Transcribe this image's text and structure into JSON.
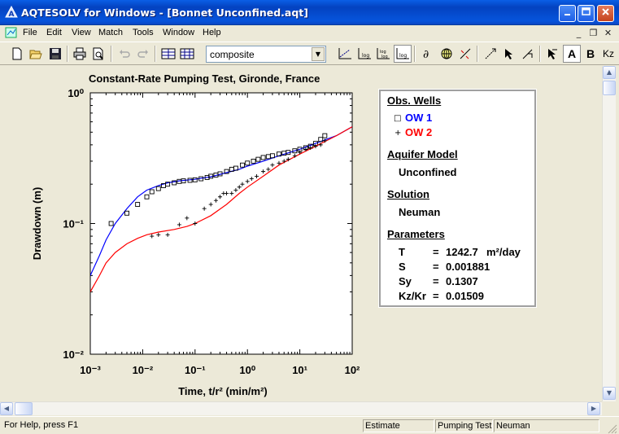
{
  "window": {
    "title": "AQTESOLV for Windows - [Bonnet Unconfined.aqt]"
  },
  "menu": [
    "File",
    "Edit",
    "View",
    "Match",
    "Tools",
    "Window",
    "Help"
  ],
  "toolbar": {
    "combo_value": "composite",
    "text_buttons": [
      "A",
      "B",
      "Kz"
    ]
  },
  "status": {
    "help": "For Help, press F1",
    "mode": "Estimate",
    "test": "Pumping Test",
    "solution": "Neuman"
  },
  "legend": {
    "obs_heading": "Obs. Wells",
    "wells": [
      {
        "name": "OW 1",
        "marker": "square",
        "color": "#0000ff"
      },
      {
        "name": "OW 2",
        "marker": "plus",
        "color": "#ff0000"
      }
    ],
    "aquifer_heading": "Aquifer Model",
    "aquifer_value": "Unconfined",
    "solution_heading": "Solution",
    "solution_value": "Neuman",
    "params_heading": "Parameters",
    "params": [
      {
        "name": "T",
        "eq": "=",
        "value": "1242.7",
        "unit": "m²/day"
      },
      {
        "name": "S",
        "eq": "=",
        "value": "0.001881",
        "unit": ""
      },
      {
        "name": "Sy",
        "eq": "=",
        "value": "0.1307",
        "unit": ""
      },
      {
        "name": "Kz/Kr",
        "eq": "=",
        "value": "0.01509",
        "unit": ""
      }
    ]
  },
  "chart_data": {
    "type": "scatter",
    "title": "Constant-Rate Pumping Test, Gironde, France",
    "xlabel": "Time, t/r² (min/m²)",
    "ylabel": "Drawdown (m)",
    "xscale": "log",
    "yscale": "log",
    "xlim": [
      0.001,
      100
    ],
    "ylim": [
      0.01,
      1
    ],
    "xticks": [
      "10⁻³",
      "10⁻²",
      "10⁻¹",
      "10⁰",
      "10¹",
      "10²"
    ],
    "yticks": [
      "10⁻²",
      "10⁻¹",
      "10⁰"
    ],
    "series": [
      {
        "name": "OW 1",
        "color": "#0000ff",
        "marker": "square",
        "points": [
          [
            0.0025,
            0.1
          ],
          [
            0.005,
            0.12
          ],
          [
            0.008,
            0.14
          ],
          [
            0.012,
            0.16
          ],
          [
            0.015,
            0.175
          ],
          [
            0.02,
            0.185
          ],
          [
            0.025,
            0.195
          ],
          [
            0.03,
            0.2
          ],
          [
            0.04,
            0.205
          ],
          [
            0.05,
            0.21
          ],
          [
            0.06,
            0.212
          ],
          [
            0.08,
            0.214
          ],
          [
            0.1,
            0.216
          ],
          [
            0.13,
            0.22
          ],
          [
            0.17,
            0.225
          ],
          [
            0.2,
            0.23
          ],
          [
            0.25,
            0.235
          ],
          [
            0.3,
            0.24
          ],
          [
            0.4,
            0.25
          ],
          [
            0.5,
            0.26
          ],
          [
            0.6,
            0.265
          ],
          [
            0.8,
            0.28
          ],
          [
            1.0,
            0.29
          ],
          [
            1.3,
            0.3
          ],
          [
            1.6,
            0.31
          ],
          [
            2.0,
            0.32
          ],
          [
            2.5,
            0.325
          ],
          [
            3,
            0.33
          ],
          [
            4,
            0.34
          ],
          [
            5,
            0.345
          ],
          [
            6,
            0.35
          ],
          [
            8,
            0.36
          ],
          [
            10,
            0.37
          ],
          [
            13,
            0.38
          ],
          [
            16,
            0.39
          ],
          [
            20,
            0.41
          ],
          [
            25,
            0.44
          ],
          [
            30,
            0.47
          ]
        ],
        "fit": [
          [
            0.001,
            0.04
          ],
          [
            0.0015,
            0.057
          ],
          [
            0.002,
            0.075
          ],
          [
            0.003,
            0.1
          ],
          [
            0.005,
            0.13
          ],
          [
            0.008,
            0.16
          ],
          [
            0.012,
            0.18
          ],
          [
            0.02,
            0.195
          ],
          [
            0.03,
            0.205
          ],
          [
            0.05,
            0.212
          ],
          [
            0.1,
            0.218
          ],
          [
            0.2,
            0.228
          ],
          [
            0.4,
            0.245
          ],
          [
            0.7,
            0.26
          ],
          [
            1,
            0.275
          ],
          [
            2,
            0.3
          ],
          [
            4,
            0.33
          ],
          [
            10,
            0.37
          ],
          [
            20,
            0.41
          ],
          [
            50,
            0.47
          ],
          [
            100,
            0.55
          ]
        ]
      },
      {
        "name": "OW 2",
        "color": "#ff0000",
        "marker": "plus",
        "points": [
          [
            0.015,
            0.08
          ],
          [
            0.02,
            0.082
          ],
          [
            0.03,
            0.082
          ],
          [
            0.05,
            0.098
          ],
          [
            0.07,
            0.11
          ],
          [
            0.1,
            0.1
          ],
          [
            0.15,
            0.13
          ],
          [
            0.2,
            0.14
          ],
          [
            0.25,
            0.15
          ],
          [
            0.3,
            0.16
          ],
          [
            0.35,
            0.17
          ],
          [
            0.4,
            0.17
          ],
          [
            0.5,
            0.17
          ],
          [
            0.6,
            0.18
          ],
          [
            0.7,
            0.19
          ],
          [
            0.8,
            0.2
          ],
          [
            1.0,
            0.21
          ],
          [
            1.2,
            0.22
          ],
          [
            1.5,
            0.23
          ],
          [
            2,
            0.25
          ],
          [
            2.5,
            0.26
          ],
          [
            3,
            0.28
          ],
          [
            4,
            0.29
          ],
          [
            5,
            0.3
          ],
          [
            6,
            0.31
          ],
          [
            8,
            0.33
          ],
          [
            10,
            0.35
          ],
          [
            13,
            0.37
          ],
          [
            16,
            0.38
          ],
          [
            20,
            0.39
          ],
          [
            25,
            0.4
          ],
          [
            30,
            0.43
          ]
        ],
        "fit": [
          [
            0.001,
            0.03
          ],
          [
            0.0015,
            0.04
          ],
          [
            0.002,
            0.05
          ],
          [
            0.003,
            0.06
          ],
          [
            0.005,
            0.07
          ],
          [
            0.008,
            0.077
          ],
          [
            0.012,
            0.082
          ],
          [
            0.02,
            0.086
          ],
          [
            0.04,
            0.09
          ],
          [
            0.07,
            0.095
          ],
          [
            0.1,
            0.1
          ],
          [
            0.2,
            0.115
          ],
          [
            0.4,
            0.14
          ],
          [
            0.7,
            0.17
          ],
          [
            1,
            0.19
          ],
          [
            2,
            0.23
          ],
          [
            4,
            0.28
          ],
          [
            10,
            0.34
          ],
          [
            20,
            0.39
          ],
          [
            50,
            0.47
          ],
          [
            100,
            0.55
          ]
        ]
      }
    ]
  }
}
